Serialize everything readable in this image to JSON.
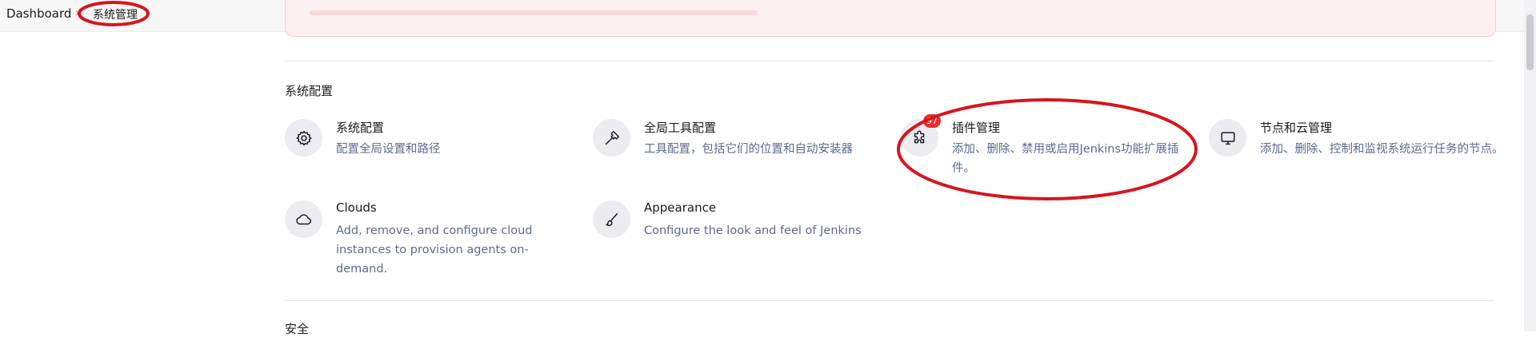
{
  "breadcrumb": {
    "items": [
      {
        "label": "Dashboard"
      },
      {
        "label": "系统管理"
      }
    ],
    "separator": "›"
  },
  "sections": {
    "system_config": {
      "title": "系统配置",
      "tiles": [
        {
          "title": "系统配置",
          "desc": "配置全局设置和路径",
          "icon": "gear-icon"
        },
        {
          "title": "全局工具配置",
          "desc": "工具配置，包括它们的位置和自动安装器",
          "icon": "hammer-icon"
        },
        {
          "title": "插件管理",
          "desc": "添加、删除、禁用或启用Jenkins功能扩展插件。",
          "icon": "puzzle-icon",
          "badge": "97"
        },
        {
          "title": "节点和云管理",
          "desc": "添加、删除、控制和监视系统运行任务的节点。",
          "icon": "monitor-icon"
        },
        {
          "title": "Clouds",
          "desc": "Add, remove, and configure cloud instances to provision agents on-demand.",
          "icon": "cloud-icon"
        },
        {
          "title": "Appearance",
          "desc": "Configure the look and feel of Jenkins",
          "icon": "brush-icon"
        }
      ]
    },
    "security": {
      "title": "安全"
    }
  },
  "colors": {
    "annotation": "#d8141e",
    "badge": "#e4312f",
    "description": "#5b6b8f"
  }
}
